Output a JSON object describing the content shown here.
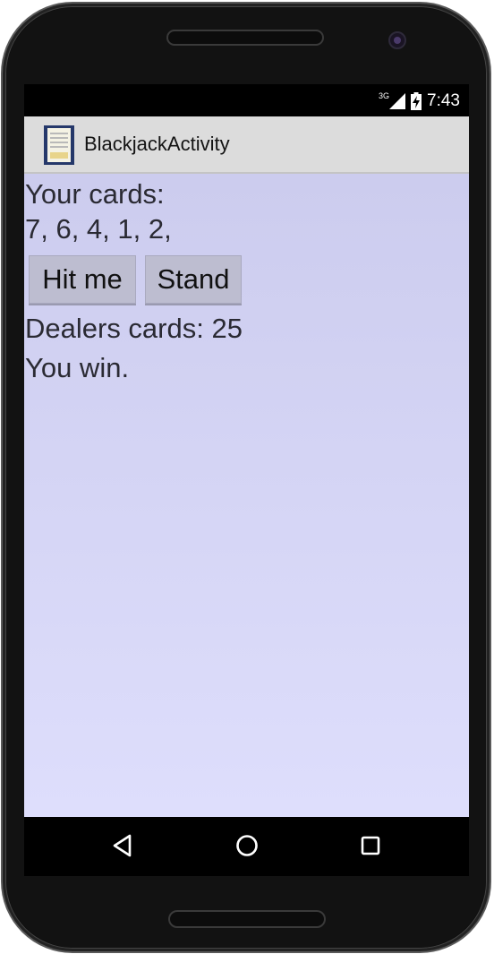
{
  "status_bar": {
    "network": "3G",
    "time": "7:43"
  },
  "action_bar": {
    "title": "BlackjackActivity",
    "icon": "app-icon"
  },
  "game": {
    "your_cards_label": "Your cards:",
    "your_cards_values": "7, 6, 4, 1, 2,",
    "hit_button": "Hit me",
    "stand_button": "Stand",
    "dealer_cards": "Dealers cards: 25",
    "result": "You win."
  },
  "nav": {
    "back_icon": "back-triangle-icon",
    "home_icon": "home-circle-icon",
    "recents_icon": "recents-square-icon"
  },
  "colors": {
    "content_top": "#ccccee",
    "content_bottom": "#dedefc",
    "action_bar": "#dcdcdc",
    "button": "#bdbdd0"
  }
}
